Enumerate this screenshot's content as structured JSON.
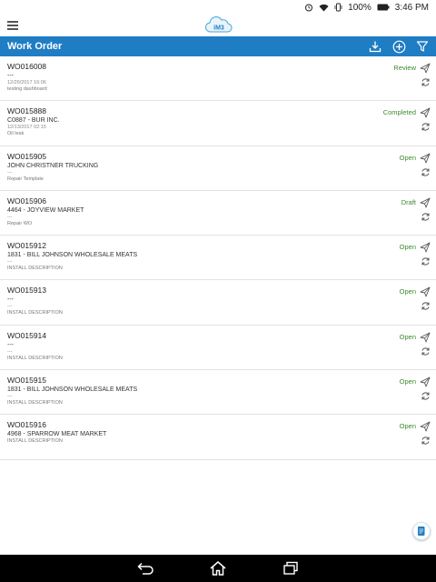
{
  "status_bar": {
    "battery": "100%",
    "time": "3:46 PM"
  },
  "app": {
    "logo_text": "iM3"
  },
  "header": {
    "title": "Work Order"
  },
  "colors": {
    "primary": "#1f7dc4",
    "status_green": "#3b8a2e"
  },
  "icons": {
    "menu": "hamburger-icon",
    "download": "download-icon",
    "add": "add-circle-icon",
    "filter": "filter-icon",
    "send": "send-icon",
    "sync": "sync-icon",
    "fab": "document-icon"
  },
  "work_orders": [
    {
      "id": "WO016008",
      "customer": "---",
      "date": "12/26/2017 16:06",
      "description": "testing dashboard",
      "status": "Review"
    },
    {
      "id": "WO015888",
      "customer": "C0887 - BUR INC.",
      "date": "12/13/2017 02:15",
      "description": "Oil leak",
      "status": "Completed"
    },
    {
      "id": "WO015905",
      "customer": "JOHN CHRISTNER TRUCKING",
      "date": "---",
      "description": "Repair Template",
      "status": "Open"
    },
    {
      "id": "WO015906",
      "customer": "4464 - JOYVIEW MARKET",
      "date": "---",
      "description": "Repair WO",
      "status": "Draft"
    },
    {
      "id": "WO015912",
      "customer": "1831 - BILL JOHNSON WHOLESALE MEATS",
      "date": "---",
      "description": "INSTALL DESCRIPTION",
      "status": "Open"
    },
    {
      "id": "WO015913",
      "customer": "---",
      "date": "---",
      "description": "INSTALL DESCRIPTION",
      "status": "Open"
    },
    {
      "id": "WO015914",
      "customer": "---",
      "date": "---",
      "description": "INSTALL DESCRIPTION",
      "status": "Open"
    },
    {
      "id": "WO015915",
      "customer": "1831 - BILL JOHNSON WHOLESALE MEATS",
      "date": "---",
      "description": "INSTALL DESCRIPTION",
      "status": "Open"
    },
    {
      "id": "WO015916",
      "customer": "4968 - SPARROW MEAT MARKET",
      "date": "",
      "description": "INSTALL DESCRIPTION",
      "status": "Open"
    }
  ]
}
